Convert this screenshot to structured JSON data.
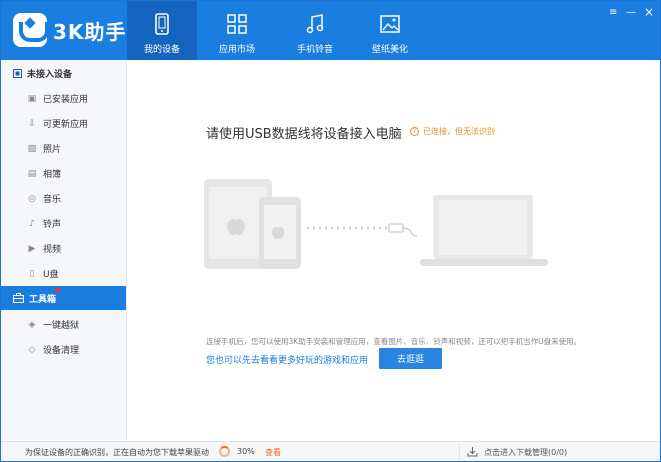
{
  "app": {
    "name": "3K助手",
    "brand_color": "#1a7ee0"
  },
  "window": {
    "menu_icon": "≡",
    "minimize_icon": "—",
    "close_icon": "×"
  },
  "nav": {
    "tabs": [
      {
        "label": "我的设备",
        "icon": "device-icon",
        "active": true
      },
      {
        "label": "应用市场",
        "icon": "grid-icon",
        "active": false
      },
      {
        "label": "手机铃音",
        "icon": "music-icon",
        "active": false
      },
      {
        "label": "壁纸美化",
        "icon": "image-icon",
        "active": false
      }
    ]
  },
  "sidebar": {
    "device_section": {
      "label": "未接入设备",
      "icon": "device-square-icon"
    },
    "device_items": [
      {
        "label": "已安装应用",
        "icon": "installed-apps-icon"
      },
      {
        "label": "可更新应用",
        "icon": "update-icon"
      },
      {
        "label": "照片",
        "icon": "photo-icon"
      },
      {
        "label": "相簿",
        "icon": "album-icon"
      },
      {
        "label": "音乐",
        "icon": "music-note-icon"
      },
      {
        "label": "铃声",
        "icon": "ringtone-icon"
      },
      {
        "label": "视频",
        "icon": "video-icon"
      },
      {
        "label": "U盘",
        "icon": "usb-drive-icon"
      }
    ],
    "toolbox_section": {
      "label": "工具箱",
      "icon": "toolbox-icon",
      "active": true
    },
    "toolbox_items": [
      {
        "label": "一键越狱",
        "icon": "jailbreak-icon"
      },
      {
        "label": "设备清理",
        "icon": "clean-icon"
      }
    ]
  },
  "main": {
    "headline": "请使用USB数据线将设备接入电脑",
    "warning": "已连接，但无法识别",
    "warning_icon": "?",
    "description": "连接手机后，您可以使用3K助手安装和管理应用，查看图片、音乐、铃声和视频，还可以把手机当作U盘来使用。",
    "link": "您也可以先去看看更多好玩的游戏和应用",
    "button": "去逛逛"
  },
  "status_bar": {
    "message": "为保证设备的正确识别，正在自动为您下载苹果驱动",
    "progress_percent": 30,
    "progress_label": "30%",
    "view_label": "查看",
    "download_label": "点击进入下载管理(0/0)"
  }
}
